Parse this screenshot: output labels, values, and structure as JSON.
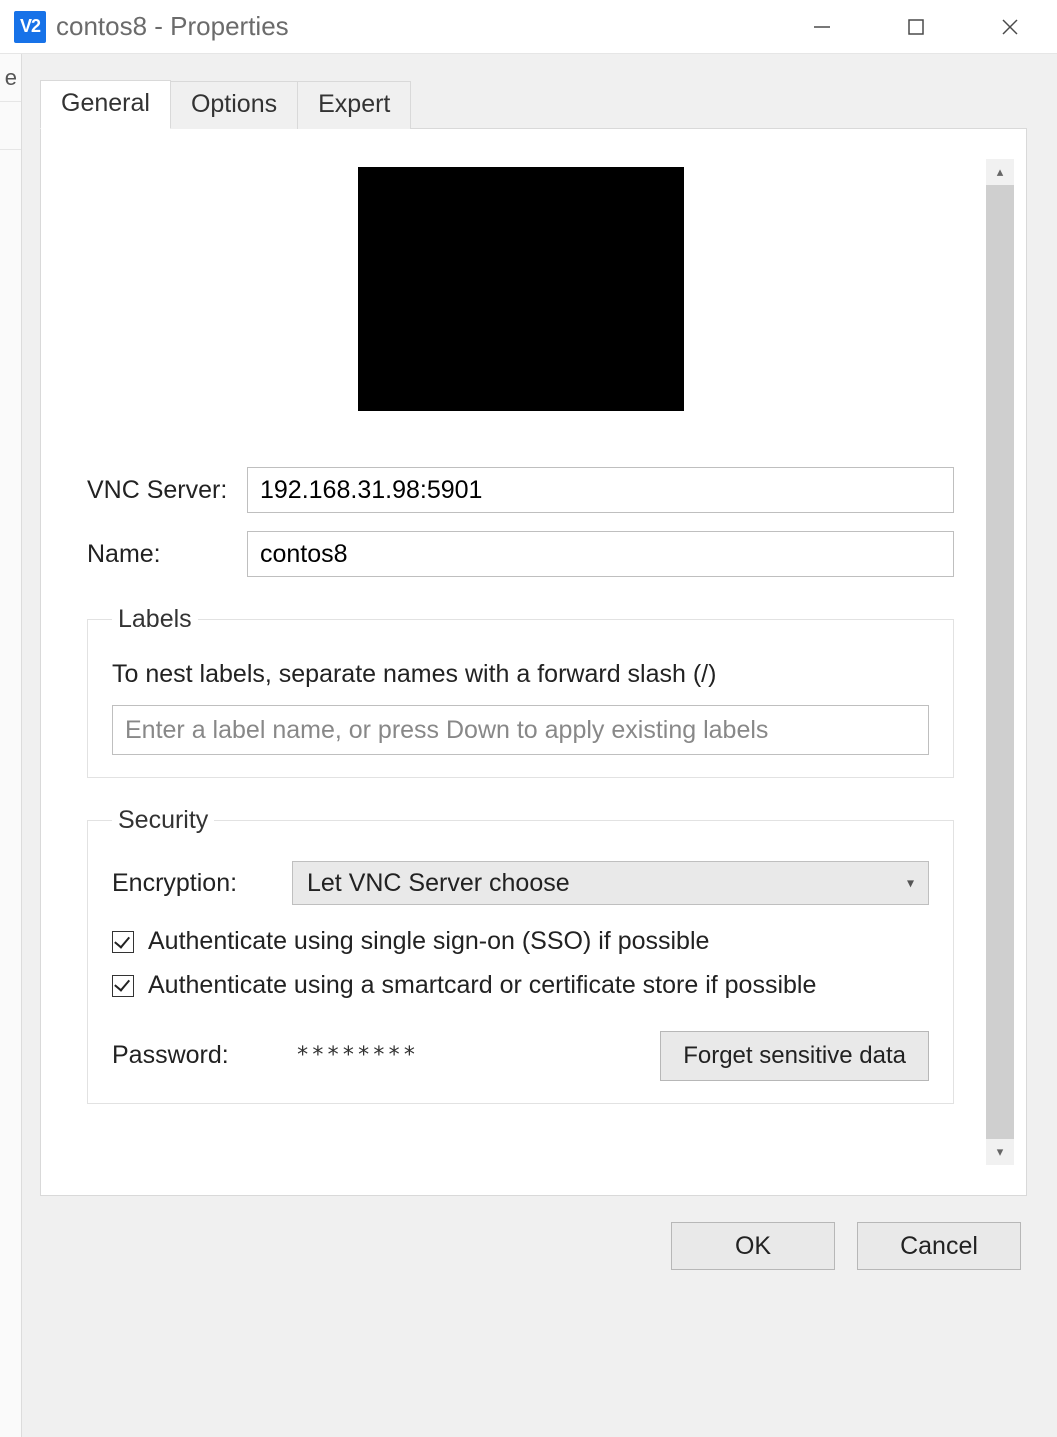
{
  "window": {
    "title": "contos8 - Properties",
    "app_icon_text": "V2"
  },
  "left_sliver_char": "e",
  "tabs": [
    "General",
    "Options",
    "Expert"
  ],
  "active_tab_index": 0,
  "general": {
    "server_label": "VNC Server:",
    "server_value": "192.168.31.98:5901",
    "name_label": "Name:",
    "name_value": "contos8",
    "labels_group": {
      "legend": "Labels",
      "hint": "To nest labels, separate names with a forward slash (/)",
      "placeholder": "Enter a label name, or press Down to apply existing labels"
    },
    "security_group": {
      "legend": "Security",
      "encryption_label": "Encryption:",
      "encryption_value": "Let VNC Server choose",
      "sso_label": "Authenticate using single sign-on (SSO) if possible",
      "sso_checked": true,
      "smartcard_label": "Authenticate using a smartcard or certificate store if possible",
      "smartcard_checked": true,
      "password_label": "Password:",
      "password_value": "********",
      "forget_label": "Forget sensitive data"
    }
  },
  "buttons": {
    "ok": "OK",
    "cancel": "Cancel"
  }
}
